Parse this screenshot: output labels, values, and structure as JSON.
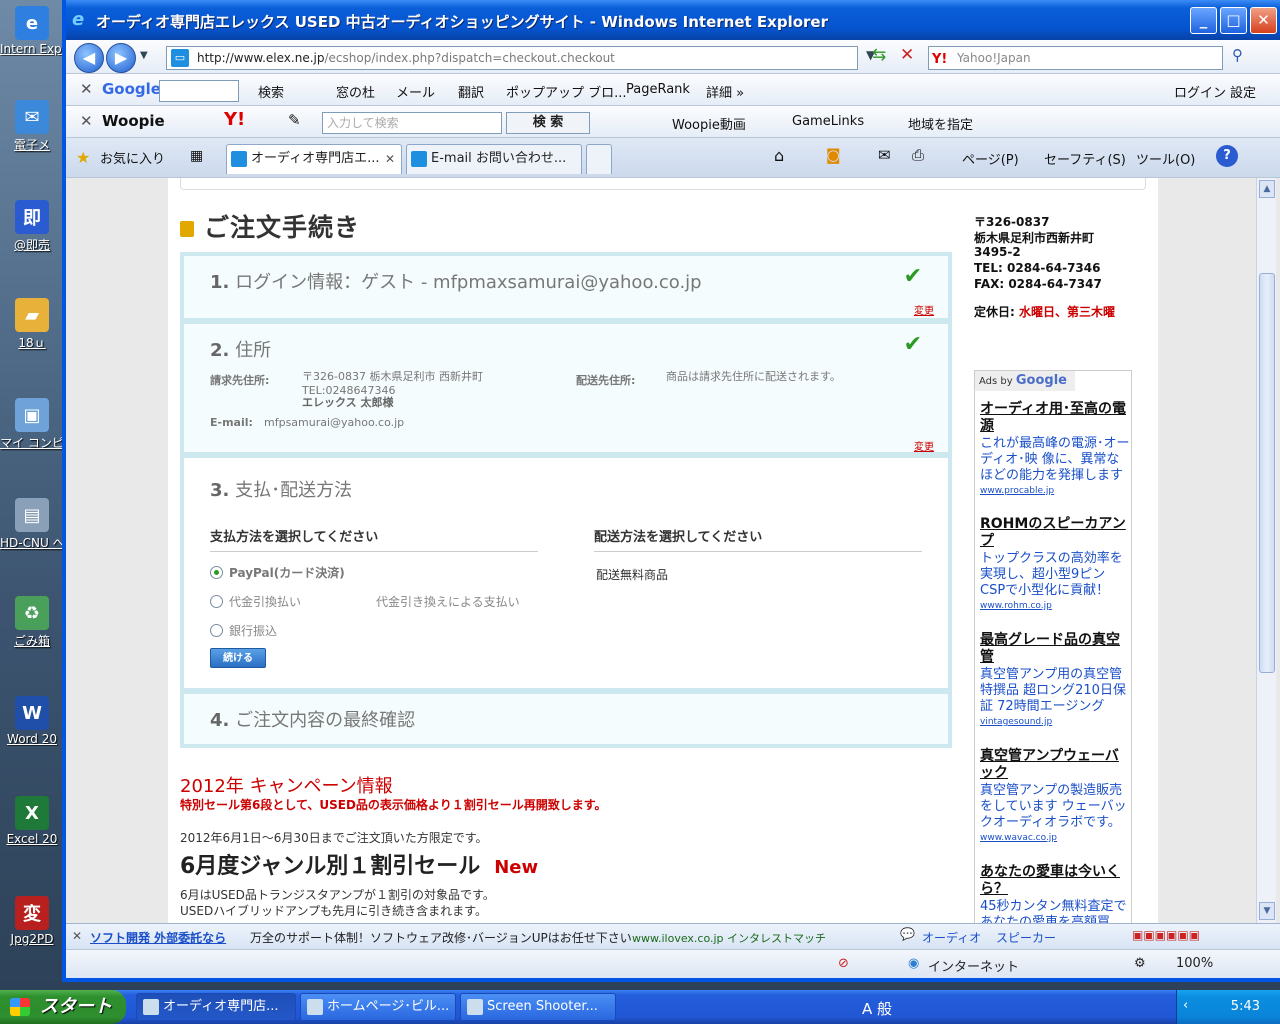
{
  "desktop": {
    "icons": [
      {
        "label": "Intern Explor",
        "icon": "ie-icon",
        "color": "#2f7fe0",
        "glyph": "e"
      },
      {
        "label": "電子メ",
        "icon": "mail-icon",
        "color": "#3b89d8",
        "glyph": "✉"
      },
      {
        "label": "@即売",
        "icon": "sale-icon",
        "color": "#2a5bd0",
        "glyph": "即"
      },
      {
        "label": "18ｕ",
        "icon": "folder-icon",
        "color": "#e8b13a",
        "glyph": "▰"
      },
      {
        "label": "マイ コンピ",
        "icon": "computer-icon",
        "color": "#6fa2d8",
        "glyph": "▣"
      },
      {
        "label": "HD-CNU へのショー",
        "icon": "drive-icon",
        "color": "#8aa0b8",
        "glyph": "▤"
      },
      {
        "label": "ごみ箱",
        "icon": "recycle-bin-icon",
        "color": "#4aa05a",
        "glyph": "♻"
      },
      {
        "label": "Word 20",
        "icon": "word-icon",
        "color": "#1f4fa8",
        "glyph": "W"
      },
      {
        "label": "Excel 20",
        "icon": "excel-icon",
        "color": "#1f7a3a",
        "glyph": "X"
      },
      {
        "label": "Jpg2PD",
        "icon": "jpg2pdf-icon",
        "color": "#b82020",
        "glyph": "変"
      }
    ]
  },
  "window": {
    "title": "オーディオ専門店エレックス USED 中古オーディオショッピングサイト - Windows Internet Explorer"
  },
  "address": {
    "url_host": "http://www.elex.ne.jp",
    "url_path": "/ecshop/index.php?dispatch=checkout.checkout",
    "search_placeholder": "Yahoo!Japan"
  },
  "google_bar": {
    "brand": "Google",
    "search_label": "検索",
    "items": [
      "窓の杜",
      "メール",
      "翻訳",
      "ポップアップ ブロ...",
      "PageRank",
      "詳細 »"
    ],
    "login": "ログイン",
    "settings": "設定"
  },
  "woopie_bar": {
    "brand": "Woopie",
    "input_placeholder": "入力して検索",
    "search_button": "検 索",
    "items": [
      "Woopie動画",
      "GameLinks",
      "地域を指定"
    ]
  },
  "tabs": {
    "favorites": "お気に入り",
    "items": [
      "オーディオ専門店エ...",
      "E-mail お問い合わせ..."
    ],
    "tools": [
      "ページ(P)",
      "セーフティ(S)",
      "ツール(O)"
    ]
  },
  "checkout": {
    "title": "ご注文手続き",
    "change_label": "変更",
    "step1": {
      "num": "1.",
      "text": "ログイン情報：ゲスト - mfpmaxsamurai@yahoo.co.jp"
    },
    "step2": {
      "num": "2.",
      "text": "住所",
      "billing_label": "請求先住所:",
      "billing_lines": [
        "〒326-0837 栃木県足利市 西新井町",
        "TEL:0248647346",
        "エレックス 太郎様"
      ],
      "shipping_label": "配送先住所:",
      "shipping_text": "商品は請求先住所に配送されます。",
      "email_label": "E-mail:",
      "email_value": "mfpsamurai@yahoo.co.jp"
    },
    "step3": {
      "num": "3.",
      "text": "支払･配送方法",
      "payment_heading": "支払方法を選択してください",
      "shipping_heading": "配送方法を選択してください",
      "payment_options": [
        "PayPal(カード決済)",
        "代金引換払い",
        "銀行振込"
      ],
      "cod_desc": "代金引き換えによる支払い",
      "shipping_value": "配送無料商品",
      "continue_button": "続ける"
    },
    "step4": {
      "num": "4.",
      "text": "ご注文内容の最終確認"
    }
  },
  "campaign": {
    "title": "2012年 キャンペーン情報",
    "subtitle": "特別セール第6段として、USED品の表示価格より１割引セール再開致します。",
    "period": "2012年6月1日～6月30日までご注文頂いた方限定です。",
    "headline": "6月度ジャンル別１割引セール",
    "new_badge": "New",
    "line1": "6月はUSED品トランジスタアンプが１割引の対象品です。",
    "line2": "USEDハイブリッドアンプも先月に引き続き含まれます。"
  },
  "sidebar": {
    "address_lines": [
      "〒326-0837",
      "栃木県足利市西新井町",
      "3495-2",
      "TEL: 0284-64-7346",
      "FAX: 0284-64-7347"
    ],
    "holiday_label": "定休日:",
    "holiday_value": "水曜日、第三木曜",
    "ads_by": "Ads by",
    "ads_brand": "Google",
    "ads": [
      {
        "title": "オーディオ用･至高の電源",
        "body": "これが最高峰の電源･オーディオ･映 像に、異常なほどの能力を発揮します",
        "url": "www.procable.jp"
      },
      {
        "title": "ROHMのスピーカアンプ",
        "body": "トップクラスの高効率を実現し、超小型9ピンCSPで小型化に貢献！",
        "url": "www.rohm.co.jp"
      },
      {
        "title": "最高グレード品の真空管",
        "body": "真空管アンプ用の真空管特撰品 超ロング210日保証 72時間エージング",
        "url": "vintagesound.jp"
      },
      {
        "title": "真空管アンプウェーバック",
        "body": "真空管アンプの製造販売をしています ウェーバックオーディオラボです。",
        "url": "www.wavac.co.jp"
      },
      {
        "title": "あなたの愛車は今いくら？",
        "body": "45秒カンタン無料査定であなたの愛車を高額買",
        "url": ""
      }
    ]
  },
  "ad_bar": {
    "link": "ソフト開発 外部委託なら",
    "text": "万全のサポート体制！ソフトウェア改修･バージョンUPはお任せ下さい",
    "site": "www.ilovex.co.jp インタレストマッチ",
    "tags": [
      "オーディオ",
      "スピーカー"
    ]
  },
  "status": {
    "zone": "インターネット",
    "zoom": "100%"
  },
  "taskbar": {
    "start": "スタート",
    "tasks": [
      "オーディオ専門店...",
      "ホームページ･ビル...",
      "Screen Shooter..."
    ],
    "ime": "A 般",
    "time": "5:43"
  }
}
